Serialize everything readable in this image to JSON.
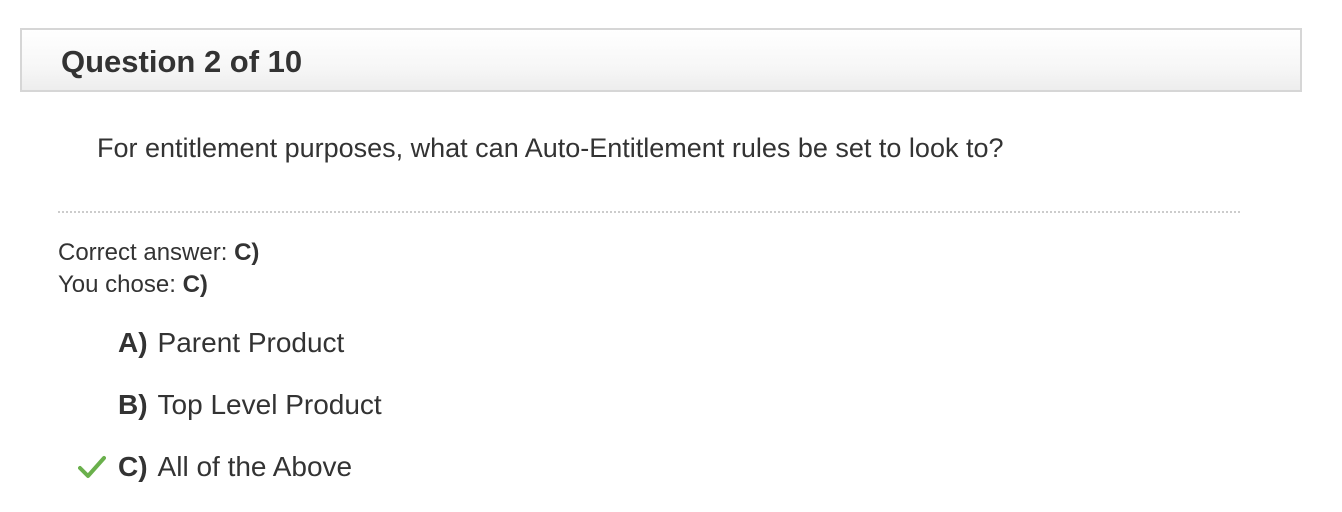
{
  "header": {
    "title": "Question 2 of 10"
  },
  "question": {
    "text": "For entitlement purposes, what can Auto-Entitlement rules be set to look to?"
  },
  "result": {
    "correct_label": "Correct answer:",
    "correct_value": "C)",
    "chose_label": "You chose:",
    "chose_value": "C)"
  },
  "options": [
    {
      "letter": "A)",
      "text": "Parent Product"
    },
    {
      "letter": "B)",
      "text": "Top Level Product"
    },
    {
      "letter": "C)",
      "text": "All of the Above",
      "icon": "check-icon"
    }
  ],
  "colors": {
    "check": "#6ab04c",
    "text": "#333333",
    "header_border": "#d6d6d6"
  }
}
